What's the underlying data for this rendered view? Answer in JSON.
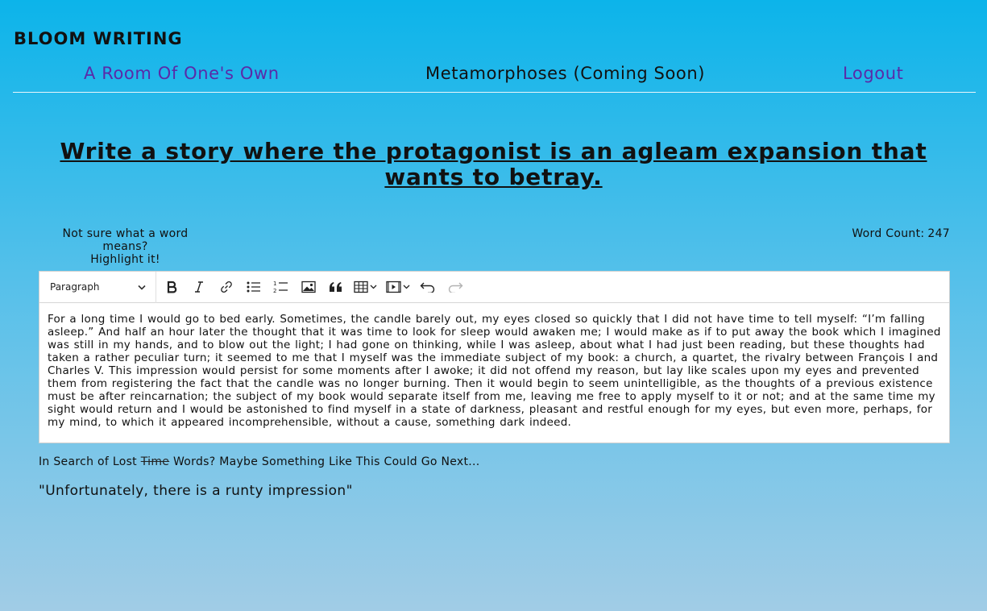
{
  "brand": "BLOOM WRITING",
  "nav": {
    "room": "A Room Of One's Own",
    "metamorphoses": "Metamorphoses (Coming Soon)",
    "logout": "Logout"
  },
  "prompt": "Write a story where the protagonist is an agleam expansion that wants to betray.",
  "hint": {
    "line1": "Not sure what a word means?",
    "line2": "Highlight it!"
  },
  "word_count": {
    "label": "Word Count:",
    "value": "247"
  },
  "editor": {
    "block_format": "Paragraph",
    "toolbar_icons": [
      "bold-icon",
      "italic-icon",
      "link-icon",
      "bulleted-list-icon",
      "numbered-list-icon",
      "image-icon",
      "quote-icon",
      "table-icon",
      "media-icon",
      "undo-icon",
      "redo-icon"
    ],
    "text": "For a long time I would go to bed early. Sometimes, the candle barely out, my eyes closed so quickly that I did not have time to tell myself: “I’m falling asleep.” And half an hour later the thought that it was time to look for sleep would awaken me; I would make as if to put away the book which I imagined was still in my hands, and to blow out the light; I had gone on thinking, while I was asleep, about what I had just been reading, but these thoughts had taken a rather peculiar turn; it seemed to me that I myself was the immediate subject of my book: a church, a quartet, the rivalry between François I and Charles V. This impression would persist for some moments after I awoke; it did not offend my reason, but lay like scales upon my eyes and prevented them from registering the fact that the candle was no longer burning. Then it would begin to seem unintelligible, as the thoughts of a previous existence must be after reincarnation; the subject of my book would separate itself from me, leaving me free to apply myself to it or not; and at the same time my sight would return and I would be astonished to find myself in a state of darkness, pleasant and restful enough for my eyes, but even more, perhaps, for my mind, to which it appeared incomprehensible, without a cause, something dark indeed."
  },
  "suggest": {
    "prefix": "In Search of Lost",
    "struck": "Time",
    "suffix": "Words? Maybe Something Like This Could Go Next..."
  },
  "suggestion": "\"Unfortunately, there is a runty impression\""
}
